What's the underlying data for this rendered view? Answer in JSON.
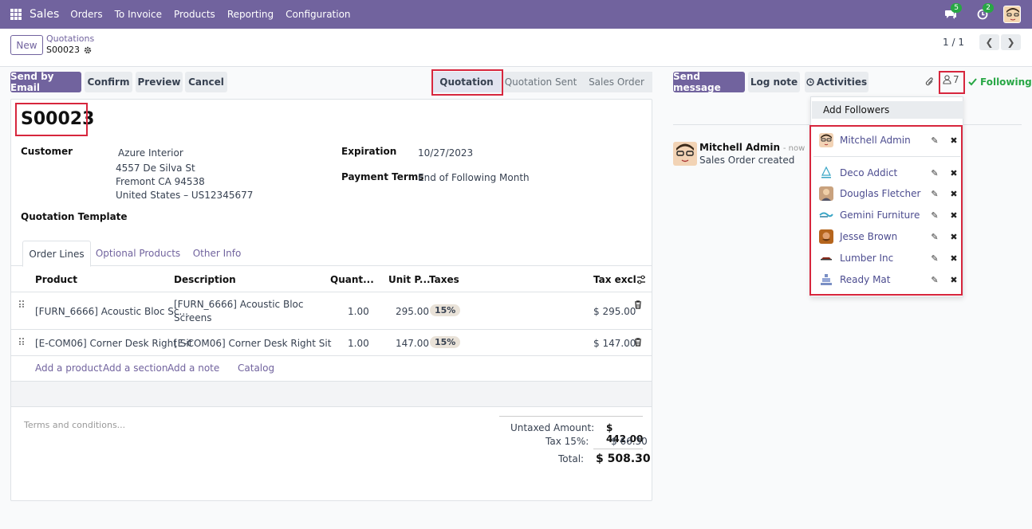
{
  "navbar": {
    "brand": "Sales",
    "menu": [
      "Orders",
      "To Invoice",
      "Products",
      "Reporting",
      "Configuration"
    ],
    "messages_count": "5",
    "activities_count": "2"
  },
  "breadcrumb": {
    "new_label": "New",
    "parent": "Quotations",
    "current": "S00023"
  },
  "pager": {
    "text": "1 / 1"
  },
  "actions": {
    "send_by_email": "Send by Email",
    "confirm": "Confirm",
    "preview": "Preview",
    "cancel": "Cancel"
  },
  "status_stages": [
    "Quotation",
    "Quotation Sent",
    "Sales Order"
  ],
  "form": {
    "reference": "S00023",
    "customer_label": "Customer",
    "customer_name": "Azure Interior",
    "customer_street": "4557 De Silva St",
    "customer_city": "Fremont CA 94538",
    "customer_country": "United States – US12345677",
    "quotation_template_label": "Quotation Template",
    "expiration_label": "Expiration",
    "expiration_value": "10/27/2023",
    "payment_terms_label": "Payment Terms",
    "payment_terms_value": "End of Following Month"
  },
  "tabs": [
    "Order Lines",
    "Optional Products",
    "Other Info"
  ],
  "table": {
    "headers": {
      "product": "Product",
      "description": "Description",
      "quantity": "Quant...",
      "unit_price": "Unit P...",
      "taxes": "Taxes",
      "tax_excl": "Tax excl."
    },
    "rows": [
      {
        "product": "[FURN_6666] Acoustic Bloc Sc...",
        "description_1": "[FURN_6666] Acoustic Bloc",
        "description_2": "Screens",
        "quantity": "1.00",
        "unit_price": "295.00",
        "tax": "15%",
        "subtotal": "$ 295.00"
      },
      {
        "product": "[E-COM06] Corner Desk Right Sit",
        "description_1": "[E-COM06] Corner Desk Right Sit",
        "description_2": "",
        "quantity": "1.00",
        "unit_price": "147.00",
        "tax": "15%",
        "subtotal": "$ 147.00"
      }
    ],
    "add_product": "Add a product",
    "add_section": "Add a section",
    "add_note": "Add a note",
    "catalog": "Catalog"
  },
  "terms_placeholder": "Terms and conditions...",
  "totals": {
    "untaxed_label": "Untaxed Amount:",
    "untaxed_value": "$ 442.00",
    "tax_label": "Tax 15%:",
    "tax_value": "$ 66.30",
    "total_label": "Total:",
    "total_value": "$ 508.30"
  },
  "chatter": {
    "send_message": "Send message",
    "log_note": "Log note",
    "activities": "Activities",
    "followers_count": "7",
    "following": "Following",
    "message_author": "Mitchell Admin",
    "message_time": "- now",
    "message_body": "Sales Order created"
  },
  "followers_dropdown": {
    "add_followers": "Add Followers",
    "followers": [
      {
        "name": "Mitchell Admin",
        "avatar_color": "#f2d3b5"
      },
      {
        "name": "Deco Addict",
        "avatar_color": "#e8f4f8"
      },
      {
        "name": "Douglas Fletcher",
        "avatar_color": "#c9a27e"
      },
      {
        "name": "Gemini Furniture",
        "avatar_color": "#d9eef7"
      },
      {
        "name": "Jesse Brown",
        "avatar_color": "#b5651d"
      },
      {
        "name": "Lumber Inc",
        "avatar_color": "#f5ebe0"
      },
      {
        "name": "Ready Mat",
        "avatar_color": "#dde3f0"
      }
    ]
  },
  "colors": {
    "brand": "#71639e",
    "highlight": "#d7263d",
    "success": "#28a745"
  }
}
